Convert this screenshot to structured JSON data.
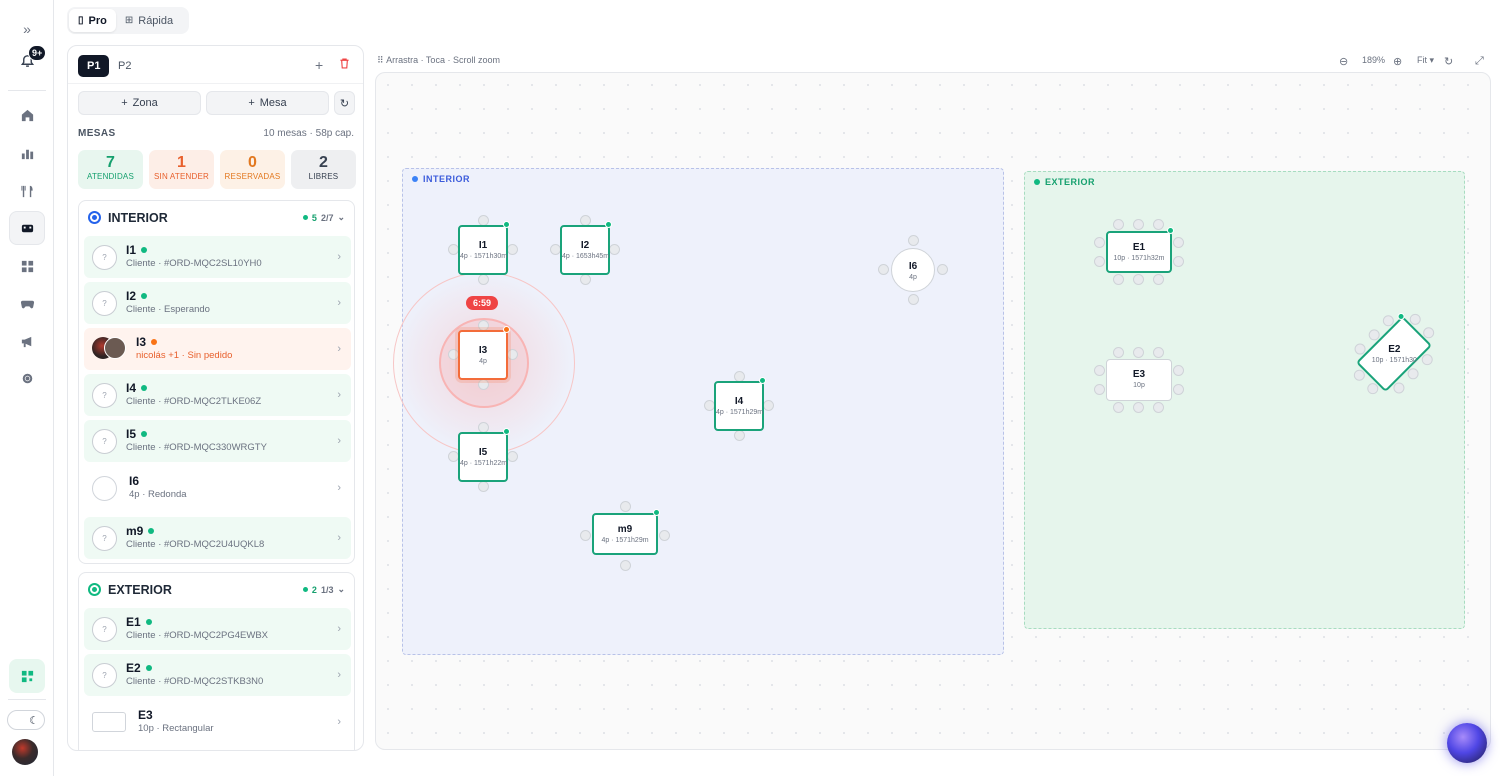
{
  "rail": {
    "notif_badge": "9+"
  },
  "mode": {
    "pro": "Pro",
    "rapida": "Rápida"
  },
  "panel": {
    "tab_p1": "P1",
    "tab_p2": "P2",
    "btn_zona": "Zona",
    "btn_mesa": "Mesa",
    "mesas_label": "MESAS",
    "mesas_summary": "10 mesas · 58p cap.",
    "stats": [
      {
        "value": "7",
        "label": "ATENDIDAS"
      },
      {
        "value": "1",
        "label": "SIN ATENDER"
      },
      {
        "value": "0",
        "label": "RESERVADAS"
      },
      {
        "value": "2",
        "label": "LIBRES"
      }
    ],
    "zones": [
      {
        "name": "INTERIOR",
        "active": "5",
        "ratio": "2/7",
        "rows": [
          {
            "name": "I1",
            "sub": "Cliente · #ORD-MQC2SL10YH0",
            "avatar": "?"
          },
          {
            "name": "I2",
            "sub": "Cliente · Esperando",
            "avatar": "?"
          },
          {
            "name": "I3",
            "sub": "nicolás +1 · Sin pedido",
            "avatar": ""
          },
          {
            "name": "I4",
            "sub": "Cliente · #ORD-MQC2TLKE06Z",
            "avatar": "?"
          },
          {
            "name": "I5",
            "sub": "Cliente · #ORD-MQC330WRGTY",
            "avatar": "?"
          },
          {
            "name": "I6",
            "sub": "4p · Redonda",
            "avatar": ""
          },
          {
            "name": "m9",
            "sub": "Cliente · #ORD-MQC2U4UQKL8",
            "avatar": "?"
          }
        ]
      },
      {
        "name": "EXTERIOR",
        "active": "2",
        "ratio": "1/3",
        "rows": [
          {
            "name": "E1",
            "sub": "Cliente · #ORD-MQC2PG4EWBX",
            "avatar": "?"
          },
          {
            "name": "E2",
            "sub": "Cliente · #ORD-MQC2STKB3N0",
            "avatar": "?"
          },
          {
            "name": "E3",
            "sub": "10p · Rectangular",
            "avatar": ""
          }
        ]
      }
    ]
  },
  "canvas": {
    "hint": "Arrastra · Toca · Scroll zoom",
    "zoom": "189%",
    "fit": "Fit",
    "timer": "6:59",
    "zone_interior": "INTERIOR",
    "zone_exterior": "EXTERIOR",
    "tables": {
      "I1": {
        "name": "I1",
        "sub": "4p · 1571h30m"
      },
      "I2": {
        "name": "I2",
        "sub": "4p · 1653h45m"
      },
      "I3": {
        "name": "I3",
        "sub": "4p"
      },
      "I4": {
        "name": "I4",
        "sub": "4p · 1571h29m"
      },
      "I5": {
        "name": "I5",
        "sub": "4p · 1571h22m"
      },
      "I6": {
        "name": "I6",
        "sub": "4p"
      },
      "m9": {
        "name": "m9",
        "sub": "4p · 1571h29m"
      },
      "E1": {
        "name": "E1",
        "sub": "10p · 1571h32m"
      },
      "E2": {
        "name": "E2",
        "sub": "10p · 1571h30"
      },
      "E3": {
        "name": "E3",
        "sub": "10p"
      }
    }
  },
  "colors": {
    "green": "#1aa37a",
    "orange": "#f36c3a",
    "blue": "#2563eb",
    "interior_bg": "#eef1fb",
    "exterior_bg": "#e6f5ec"
  }
}
